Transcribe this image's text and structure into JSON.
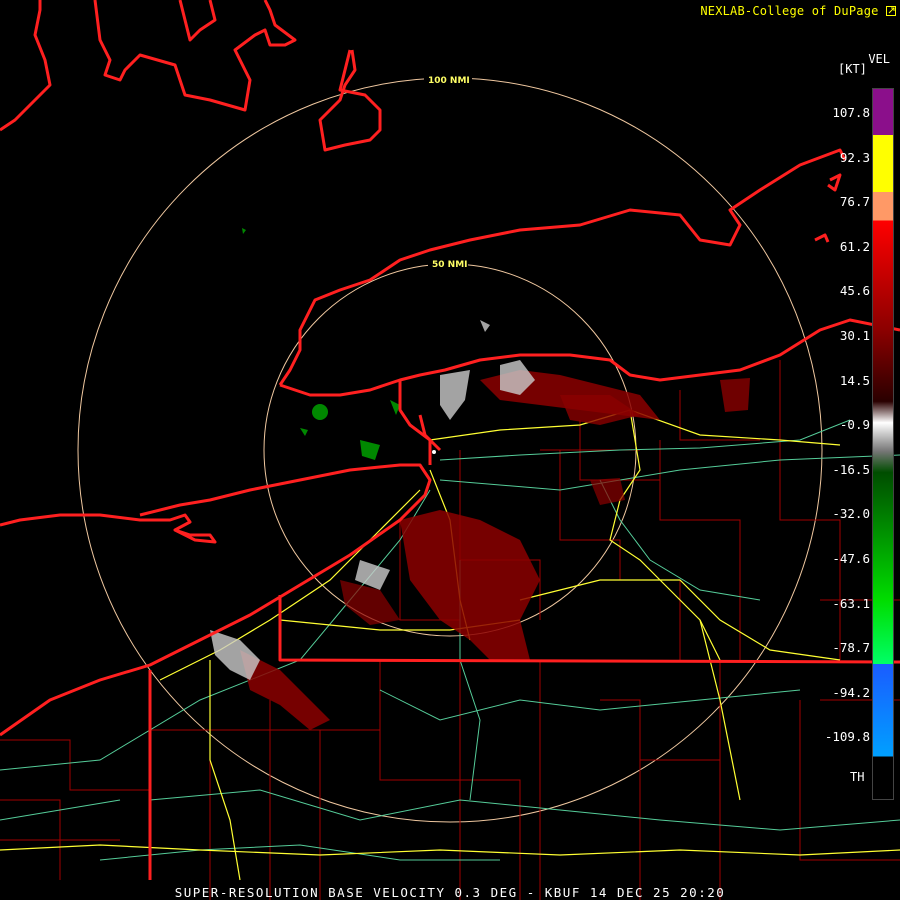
{
  "credit": "NEXLAB-College of DuPage",
  "credit_icon": "external-link-icon",
  "legend": {
    "units": "[KT]",
    "product": "VEL",
    "ticks": [
      "107.8",
      "92.3",
      "76.7",
      "61.2",
      "45.6",
      "30.1",
      "14.5",
      "-0.9",
      "-16.5",
      "-32.0",
      "-47.6",
      "-63.1",
      "-78.7",
      "-94.2",
      "-109.8"
    ],
    "bottom_label": "TH",
    "colors": [
      "#8b0f8b",
      "#ffff00",
      "#ff9966",
      "#ff0000",
      "#8b0000",
      "#2a0000",
      "#ffffff",
      "#777777",
      "#004d00",
      "#00dd00",
      "#00ff66",
      "#1a5cff",
      "#00a0ff",
      "#000000"
    ]
  },
  "rings": {
    "inner": "50 NMI",
    "outer": "100 NMI"
  },
  "footer": "SUPER-RESOLUTION BASE VELOCITY 0.3 DEG - KBUF 14 DEC 25 20:20",
  "colors": {
    "background": "#000000",
    "state_borders": "#ff2020",
    "county_borders": "#a00000",
    "highways": "#ffff33",
    "secondary_roads": "#55cc99",
    "range_rings": "#f0c8a0"
  }
}
